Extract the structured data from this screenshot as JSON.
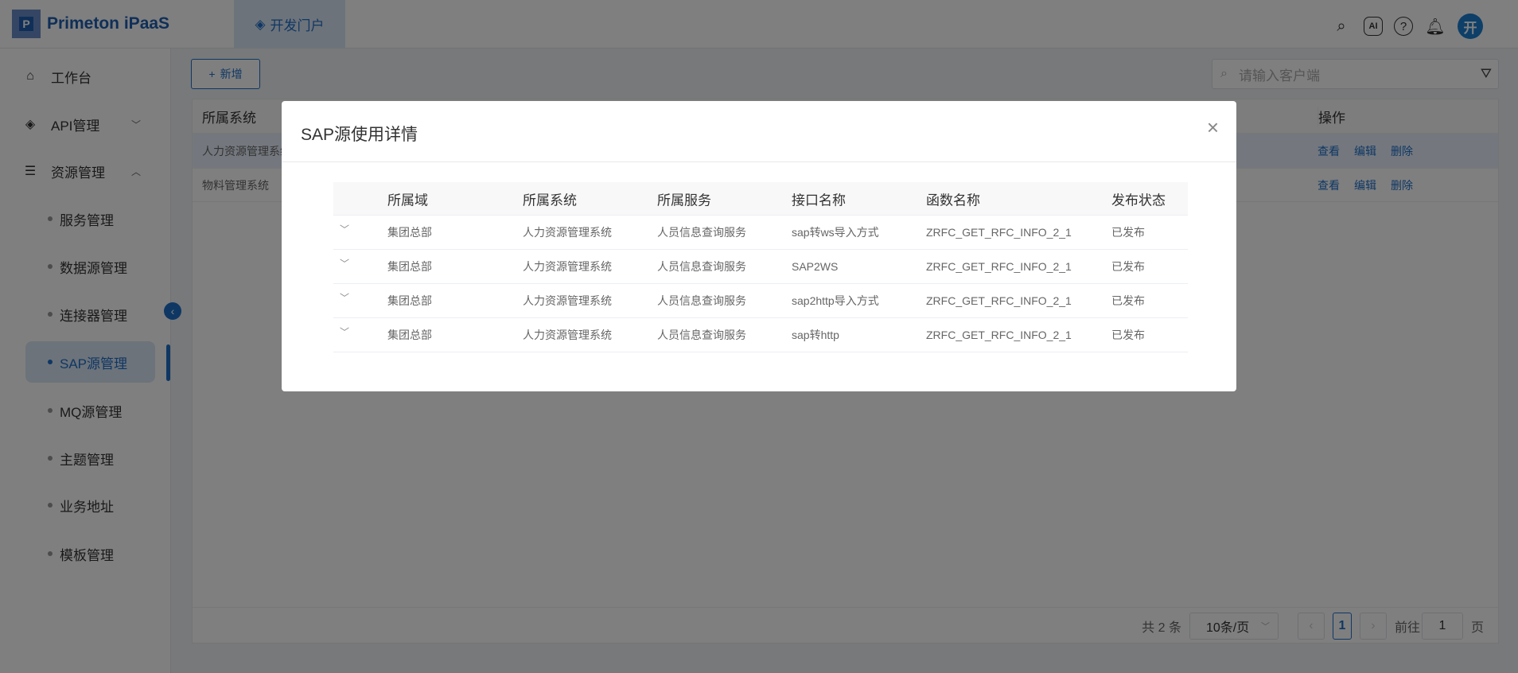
{
  "header": {
    "logo": "Primeton iPaaS",
    "logo_letter": "P",
    "tab": "开发门户",
    "avatar": "开",
    "icons": [
      "search-icon",
      "ai-icon",
      "help-icon",
      "bell-icon"
    ]
  },
  "sidebar": {
    "items": [
      {
        "label": "工作台",
        "icon": "home-icon"
      },
      {
        "label": "API管理",
        "icon": "layers-icon"
      },
      {
        "label": "资源管理",
        "icon": "database-icon"
      }
    ],
    "sub_items": [
      "服务管理",
      "数据源管理",
      "连接器管理",
      "SAP源管理",
      "MQ源管理",
      "主题管理",
      "业务地址",
      "模板管理"
    ],
    "active": "SAP源管理"
  },
  "toolbar": {
    "add_label": "新增",
    "search_placeholder": "请输入客户端"
  },
  "table": {
    "headers": {
      "system": "所属系统",
      "ops": "操作"
    },
    "rows": [
      {
        "system": "人力资源管理系统"
      },
      {
        "system": "物料管理系统"
      }
    ],
    "ops": [
      "查看",
      "编辑",
      "删除"
    ]
  },
  "pagination": {
    "total": "共 2 条",
    "page_size": "10条/页",
    "current": "1",
    "goto_label": "前往",
    "goto_value": "1",
    "page_suffix": "页"
  },
  "modal": {
    "title": "SAP源使用详情",
    "headers": [
      "所属域",
      "所属系统",
      "所属服务",
      "接口名称",
      "函数名称",
      "发布状态"
    ],
    "rows": [
      [
        "集团总部",
        "人力资源管理系统",
        "人员信息查询服务",
        "sap转ws导入方式",
        "ZRFC_GET_RFC_INFO_2_1",
        "已发布"
      ],
      [
        "集团总部",
        "人力资源管理系统",
        "人员信息查询服务",
        "SAP2WS",
        "ZRFC_GET_RFC_INFO_2_1",
        "已发布"
      ],
      [
        "集团总部",
        "人力资源管理系统",
        "人员信息查询服务",
        "sap2http导入方式",
        "ZRFC_GET_RFC_INFO_2_1",
        "已发布"
      ],
      [
        "集团总部",
        "人力资源管理系统",
        "人员信息查询服务",
        "sap转http",
        "ZRFC_GET_RFC_INFO_2_1",
        "已发布"
      ]
    ]
  }
}
